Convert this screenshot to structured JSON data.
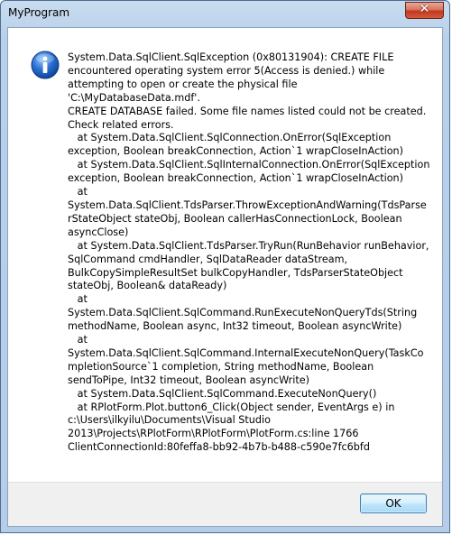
{
  "window": {
    "title": "MyProgram",
    "close_label": "✕"
  },
  "dialog": {
    "icon": "information-icon",
    "message": "System.Data.SqlClient.SqlException (0x80131904): CREATE FILE encountered operating system error 5(Access is denied.) while attempting to open or create the physical file 'C:\\MyDatabaseData.mdf'.\nCREATE DATABASE failed. Some file names listed could not be created. Check related errors.\n   at System.Data.SqlClient.SqlConnection.OnError(SqlException exception, Boolean breakConnection, Action`1 wrapCloseInAction)\n   at System.Data.SqlClient.SqlInternalConnection.OnError(SqlException exception, Boolean breakConnection, Action`1 wrapCloseInAction)\n   at\nSystem.Data.SqlClient.TdsParser.ThrowExceptionAndWarning(TdsParserStateObject stateObj, Boolean callerHasConnectionLock, Boolean asyncClose)\n   at System.Data.SqlClient.TdsParser.TryRun(RunBehavior runBehavior, SqlCommand cmdHandler, SqlDataReader dataStream, BulkCopySimpleResultSet bulkCopyHandler, TdsParserStateObject stateObj, Boolean& dataReady)\n   at\nSystem.Data.SqlClient.SqlCommand.RunExecuteNonQueryTds(String methodName, Boolean async, Int32 timeout, Boolean asyncWrite)\n   at\nSystem.Data.SqlClient.SqlCommand.InternalExecuteNonQuery(TaskCompletionSource`1 completion, String methodName, Boolean sendToPipe, Int32 timeout, Boolean asyncWrite)\n   at System.Data.SqlClient.SqlCommand.ExecuteNonQuery()\n   at RPlotForm.Plot.button6_Click(Object sender, EventArgs e) in c:\\Users\\ilkyilu\\Documents\\Visual Studio 2013\\Projects\\RPlotForm\\RPlotForm\\PlotForm.cs:line 1766\nClientConnectionId:80feffa8-bb92-4b7b-b488-c590e7fc6bfd",
    "ok_label": "OK"
  },
  "colors": {
    "icon_blue": "#2a6fd0",
    "close_red": "#c0391f",
    "ok_border": "#3c7fb1"
  }
}
